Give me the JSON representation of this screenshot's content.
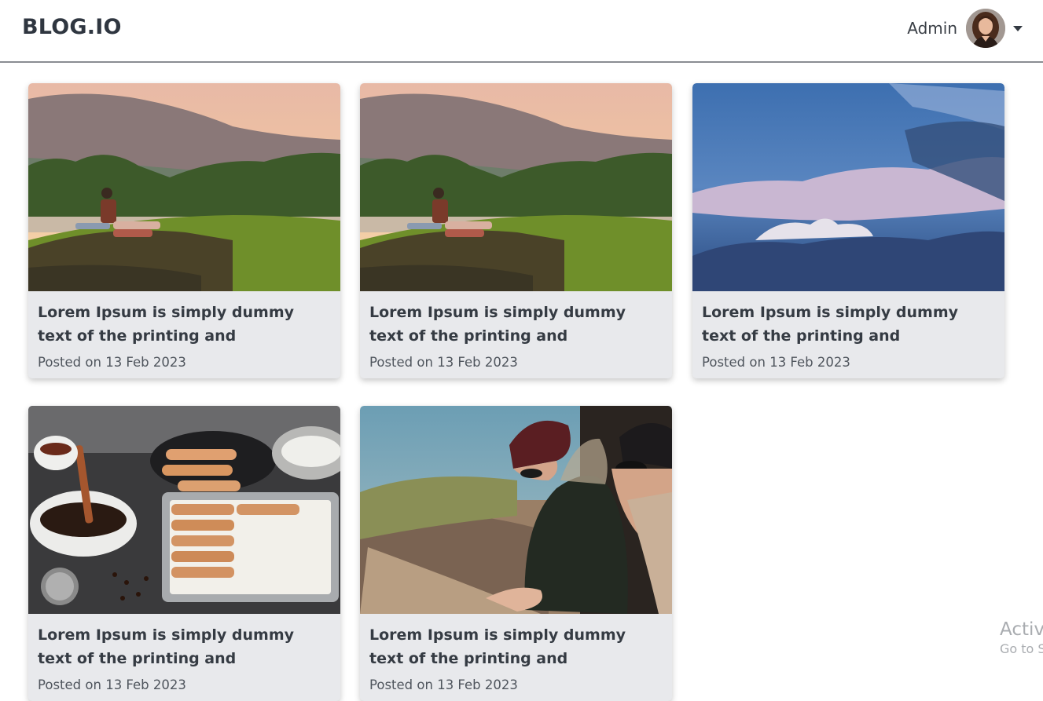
{
  "header": {
    "brand": "BLOG.IO",
    "user_name": "Admin"
  },
  "posts": [
    {
      "title": "Lorem Ipsum is simply dummy text of the printing and typesetting…",
      "date": "Posted on 13 Feb 2023",
      "image": "couple-on-grassy-rock-at-sunset"
    },
    {
      "title": "Lorem Ipsum is simply dummy text of the printing and typesetting…",
      "date": "Posted on 13 Feb 2023",
      "image": "couple-on-grassy-rock-at-sunset"
    },
    {
      "title": "Lorem Ipsum is simply dummy text of the printing and typesetting…",
      "date": "Posted on 13 Feb 2023",
      "image": "blue-sky-with-clouds"
    },
    {
      "title": "Lorem Ipsum is simply dummy text of the printing and typesetting…",
      "date": "Posted on 13 Feb 2023",
      "image": "tiramisu-ingredients"
    },
    {
      "title": "Lorem Ipsum is simply dummy text of the printing and typesetting…",
      "date": "Posted on 13 Feb 2023",
      "image": "two-people-in-winter-hats"
    }
  ],
  "os_overlay": {
    "line1": "Activ",
    "line2": "Go to S"
  },
  "colors": {
    "card_background": "#e8e9ec",
    "title_text": "#353b43",
    "header_divider": "#8a8d92"
  }
}
